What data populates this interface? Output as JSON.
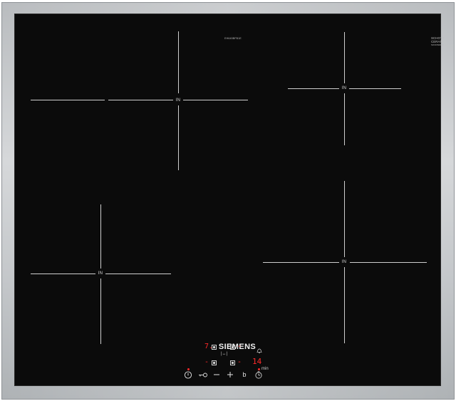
{
  "appliance": {
    "brand": "SIEMENS",
    "model_code": "EH645BFB1E",
    "glass_maker": [
      "SCHOTT",
      "CERAN"
    ],
    "glass_maker_small": "SOCDS0000"
  },
  "zones": [
    {
      "id": "front-left-upper",
      "label": "IN"
    },
    {
      "id": "rear-right",
      "label": "IN"
    },
    {
      "id": "front-left-lower",
      "label": "IN"
    },
    {
      "id": "front-right",
      "label": "IN"
    }
  ],
  "control_panel": {
    "display_left_top": "7.",
    "display_left_bottom": "-",
    "display_right_top": "-",
    "display_right_bottom": "-",
    "timer_display": "14",
    "timer_unit": "min",
    "icons": [
      "power-icon",
      "childlock-icon",
      "minus-icon",
      "plus-icon",
      "boost-icon",
      "timer-icon",
      "bell-icon"
    ]
  },
  "colors": {
    "glass": "#0b0b0b",
    "frame": "#c4c7ca",
    "markings": "#cfcfcf",
    "display_red": "#ff2a2a"
  }
}
